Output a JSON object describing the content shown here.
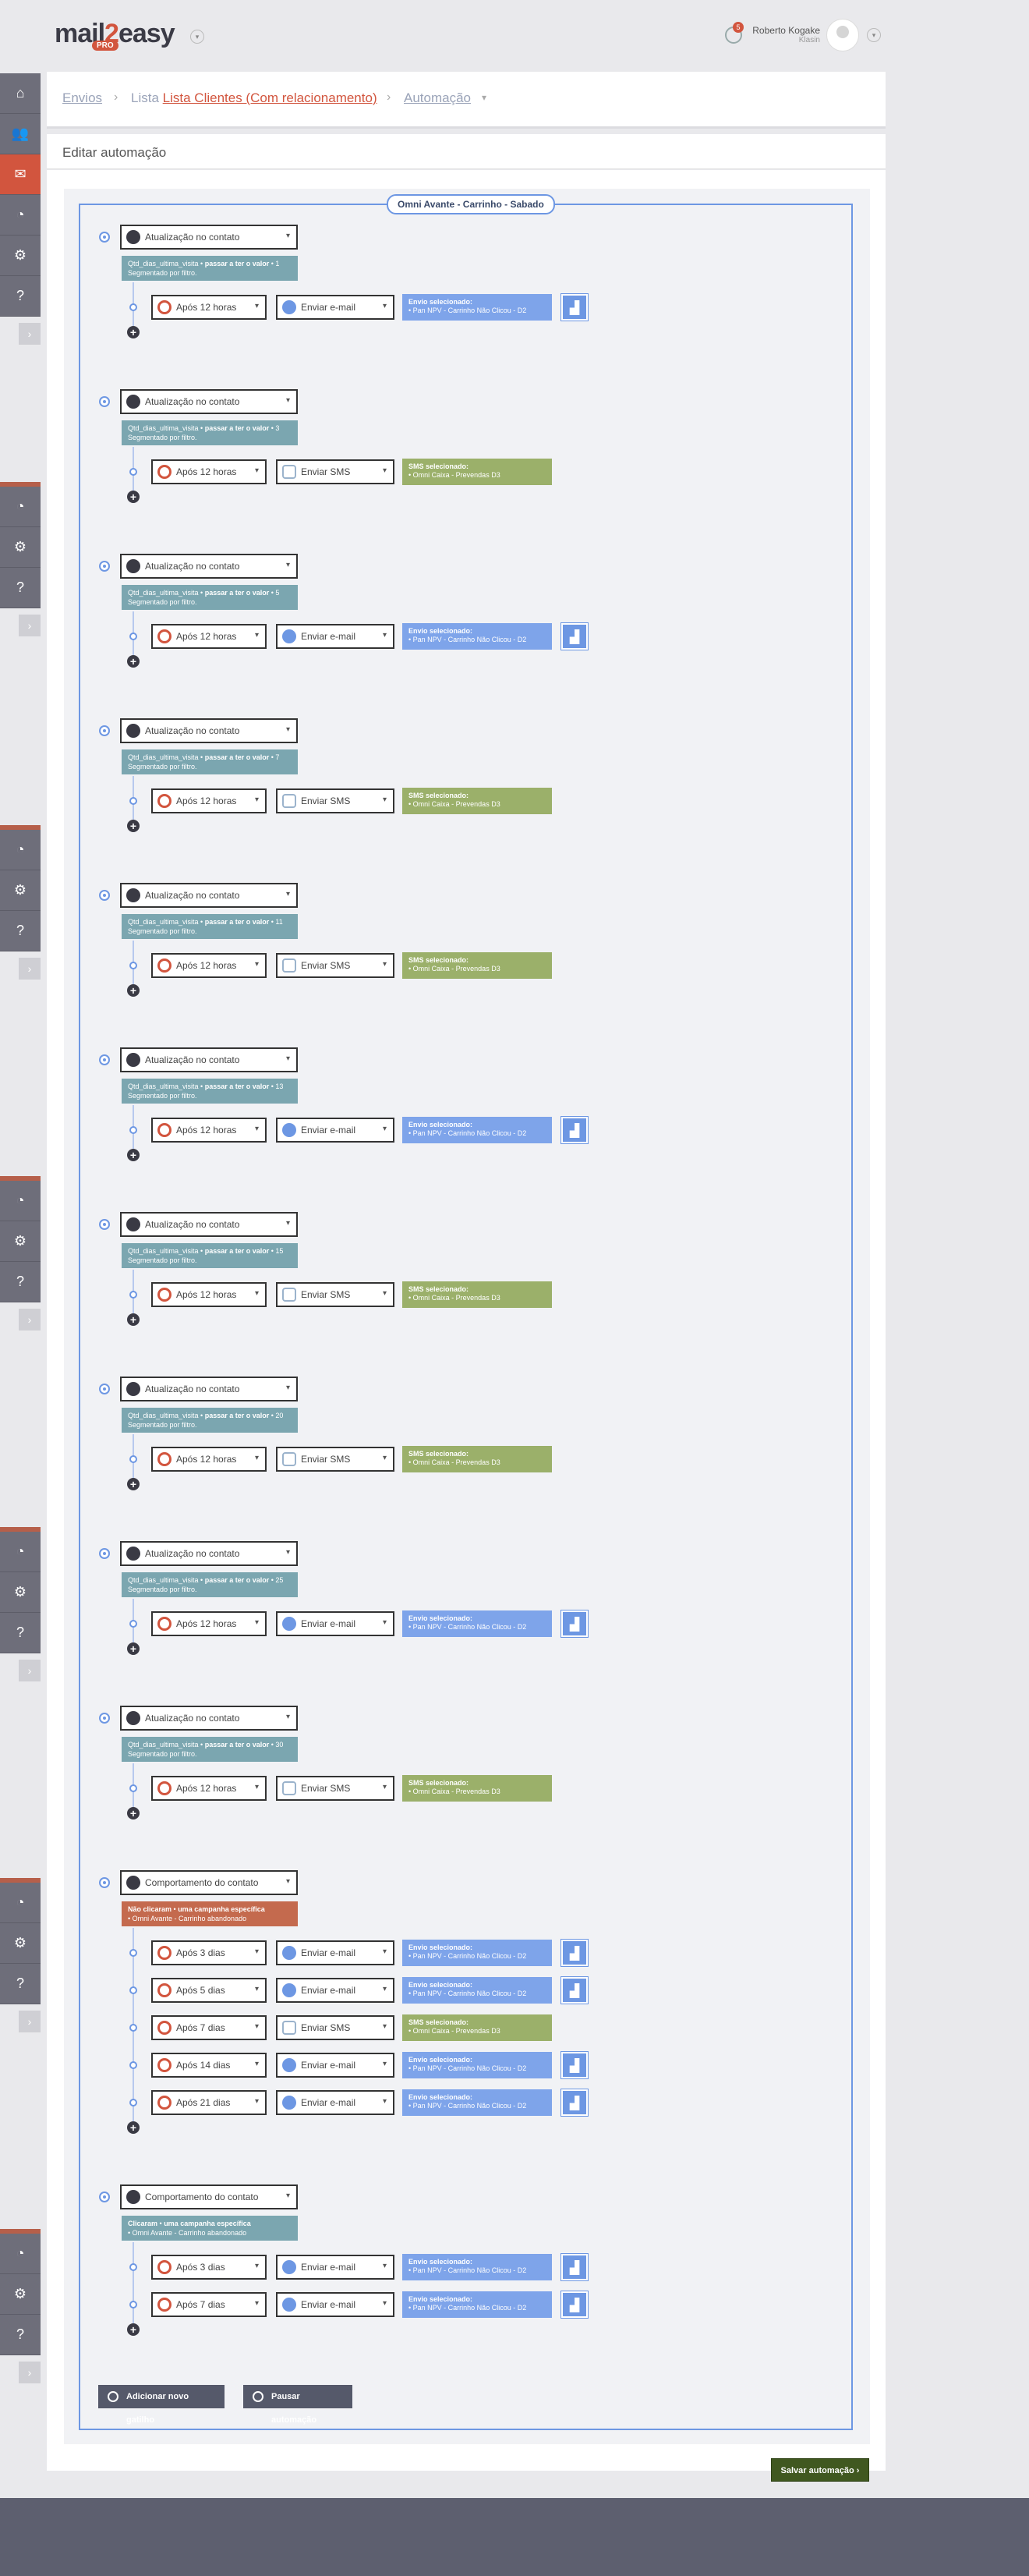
{
  "header": {
    "logo_main": "mail",
    "logo_two": "2",
    "logo_rest": "easy",
    "logo_badge": "PRO",
    "notifications_count": "5",
    "user_name": "Roberto Kogake",
    "user_company": "Klasin"
  },
  "breadcrumb": {
    "item1": "Envios",
    "item2_prefix": "Lista",
    "item2_link": "Lista Clientes (Com relacionamento)",
    "item3": "Automação"
  },
  "page": {
    "title": "Editar automação",
    "automation_name": "Omni Avante - Carrinho - Sabado"
  },
  "triggers": [
    {
      "type": "Atualização no contato",
      "cond_field": "Qtd_dias_ultima_visita",
      "cond_verb": "passar a ter o valor",
      "cond_value": "1",
      "seg": "Segmentado por filtro.",
      "steps": [
        {
          "delay": "Após 12 horas",
          "action": "Enviar e-mail",
          "kind": "email",
          "info_title": "Envio selecionado:",
          "info_text": "• Pan NPV - Carrinho Não Clicou - D2"
        }
      ]
    },
    {
      "type": "Atualização no contato",
      "cond_field": "Qtd_dias_ultima_visita",
      "cond_verb": "passar a ter o valor",
      "cond_value": "3",
      "seg": "Segmentado por filtro.",
      "steps": [
        {
          "delay": "Após 12 horas",
          "action": "Enviar SMS",
          "kind": "sms",
          "info_title": "SMS selecionado:",
          "info_text": "• Omni Caixa - Prevendas D3"
        }
      ]
    },
    {
      "type": "Atualização no contato",
      "cond_field": "Qtd_dias_ultima_visita",
      "cond_verb": "passar a ter o valor",
      "cond_value": "5",
      "seg": "Segmentado por filtro.",
      "steps": [
        {
          "delay": "Após 12 horas",
          "action": "Enviar e-mail",
          "kind": "email",
          "info_title": "Envio selecionado:",
          "info_text": "• Pan NPV - Carrinho Não Clicou - D2"
        }
      ]
    },
    {
      "type": "Atualização no contato",
      "cond_field": "Qtd_dias_ultima_visita",
      "cond_verb": "passar a ter o valor",
      "cond_value": "7",
      "seg": "Segmentado por filtro.",
      "steps": [
        {
          "delay": "Após 12 horas",
          "action": "Enviar SMS",
          "kind": "sms",
          "info_title": "SMS selecionado:",
          "info_text": "• Omni Caixa - Prevendas D3"
        }
      ]
    },
    {
      "type": "Atualização no contato",
      "cond_field": "Qtd_dias_ultima_visita",
      "cond_verb": "passar a ter o valor",
      "cond_value": "11",
      "seg": "Segmentado por filtro.",
      "steps": [
        {
          "delay": "Após 12 horas",
          "action": "Enviar SMS",
          "kind": "sms",
          "info_title": "SMS selecionado:",
          "info_text": "• Omni Caixa - Prevendas D3"
        }
      ]
    },
    {
      "type": "Atualização no contato",
      "cond_field": "Qtd_dias_ultima_visita",
      "cond_verb": "passar a ter o valor",
      "cond_value": "13",
      "seg": "Segmentado por filtro.",
      "steps": [
        {
          "delay": "Após 12 horas",
          "action": "Enviar e-mail",
          "kind": "email",
          "info_title": "Envio selecionado:",
          "info_text": "• Pan NPV - Carrinho Não Clicou - D2"
        }
      ]
    },
    {
      "type": "Atualização no contato",
      "cond_field": "Qtd_dias_ultima_visita",
      "cond_verb": "passar a ter o valor",
      "cond_value": "15",
      "seg": "Segmentado por filtro.",
      "steps": [
        {
          "delay": "Após 12 horas",
          "action": "Enviar SMS",
          "kind": "sms",
          "info_title": "SMS selecionado:",
          "info_text": "• Omni Caixa - Prevendas D3"
        }
      ]
    },
    {
      "type": "Atualização no contato",
      "cond_field": "Qtd_dias_ultima_visita",
      "cond_verb": "passar a ter o valor",
      "cond_value": "20",
      "seg": "Segmentado por filtro.",
      "steps": [
        {
          "delay": "Após 12 horas",
          "action": "Enviar SMS",
          "kind": "sms",
          "info_title": "SMS selecionado:",
          "info_text": "• Omni Caixa - Prevendas D3"
        }
      ]
    },
    {
      "type": "Atualização no contato",
      "cond_field": "Qtd_dias_ultima_visita",
      "cond_verb": "passar a ter o valor",
      "cond_value": "25",
      "seg": "Segmentado por filtro.",
      "steps": [
        {
          "delay": "Após 12 horas",
          "action": "Enviar e-mail",
          "kind": "email",
          "info_title": "Envio selecionado:",
          "info_text": "• Pan NPV - Carrinho Não Clicou - D2"
        }
      ]
    },
    {
      "type": "Atualização no contato",
      "cond_field": "Qtd_dias_ultima_visita",
      "cond_verb": "passar a ter o valor",
      "cond_value": "30",
      "seg": "Segmentado por filtro.",
      "steps": [
        {
          "delay": "Após 12 horas",
          "action": "Enviar SMS",
          "kind": "sms",
          "info_title": "SMS selecionado:",
          "info_text": "• Omni Caixa - Prevendas D3"
        }
      ]
    },
    {
      "type": "Comportamento do contato",
      "style": "red",
      "cond_field": "Não clicaram",
      "cond_verb": "uma campanha específica",
      "cond_value": "",
      "seg": "• Omni Avante - Carrinho abandonado",
      "steps": [
        {
          "delay": "Após 3 dias",
          "action": "Enviar e-mail",
          "kind": "email",
          "info_title": "Envio selecionado:",
          "info_text": "• Pan NPV - Carrinho Não Clicou - D2"
        },
        {
          "delay": "Após 5 dias",
          "action": "Enviar e-mail",
          "kind": "email",
          "info_title": "Envio selecionado:",
          "info_text": "• Pan NPV - Carrinho Não Clicou - D2"
        },
        {
          "delay": "Após 7 dias",
          "action": "Enviar SMS",
          "kind": "sms",
          "info_title": "SMS selecionado:",
          "info_text": "• Omni Caixa - Prevendas D3"
        },
        {
          "delay": "Após 14 dias",
          "action": "Enviar e-mail",
          "kind": "email",
          "info_title": "Envio selecionado:",
          "info_text": "• Pan NPV - Carrinho Não Clicou - D2"
        },
        {
          "delay": "Após 21 dias",
          "action": "Enviar e-mail",
          "kind": "email",
          "info_title": "Envio selecionado:",
          "info_text": "• Pan NPV - Carrinho Não Clicou - D2"
        }
      ]
    },
    {
      "type": "Comportamento do contato",
      "style": "teal",
      "cond_field": "Clicaram",
      "cond_verb": "uma campanha específica",
      "cond_value": "",
      "seg": "• Omni Avante - Carrinho abandonado",
      "steps": [
        {
          "delay": "Após 3 dias",
          "action": "Enviar e-mail",
          "kind": "email",
          "info_title": "Envio selecionado:",
          "info_text": "• Pan NPV - Carrinho Não Clicou - D2"
        },
        {
          "delay": "Após 7 dias",
          "action": "Enviar e-mail",
          "kind": "email",
          "info_title": "Envio selecionado:",
          "info_text": "• Pan NPV - Carrinho Não Clicou - D2"
        }
      ]
    }
  ],
  "buttons": {
    "add_trigger": "Adicionar novo gatilho",
    "pause": "Pausar automação",
    "save": "Salvar automação"
  },
  "icons": {
    "sidebar": [
      "home-icon",
      "users-icon",
      "mail-icon",
      "chart-pie-icon",
      "gear-icon",
      "help-icon"
    ]
  },
  "colors": {
    "accent": "#d2553e",
    "email_box": "#7ea4ea",
    "sms_box": "#9bb06a",
    "condition": "#7ba6b0",
    "condition_negative": "#c46a4e",
    "save": "#405820"
  }
}
